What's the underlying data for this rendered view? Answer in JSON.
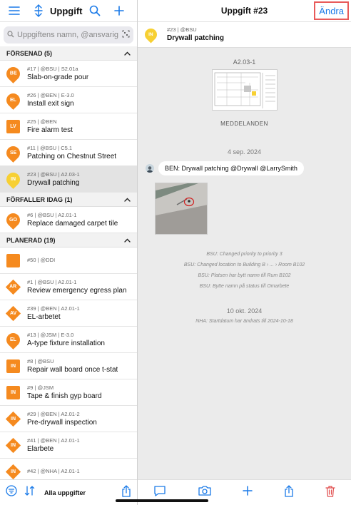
{
  "colors": {
    "accent": "#1a7ae8",
    "orange": "#f58a1f",
    "yellow": "#f7d033",
    "delete": "#e04a4a"
  },
  "left": {
    "title": "Uppgift",
    "search_placeholder": "Uppgiftens namn, @ansvarig, #t...",
    "sections": [
      {
        "label": "FÖRSENAD (5)",
        "items": [
          {
            "badge": "BE",
            "shape": "pin",
            "color": "orange",
            "meta": "#17 | @BSU | S2.01a",
            "name": "Slab-on-grade pour"
          },
          {
            "badge": "EL",
            "shape": "pin",
            "color": "orange",
            "meta": "#26 | @BEN | E-3.0",
            "name": "Install exit sign"
          },
          {
            "badge": "LV",
            "shape": "square",
            "color": "orange",
            "meta": "#25 | @BEN",
            "name": "Fire alarm test"
          },
          {
            "badge": "SE",
            "shape": "pin",
            "color": "orange",
            "meta": "#11 | @BSU | C5.1",
            "name": "Patching on Chestnut Street"
          },
          {
            "badge": "IN",
            "shape": "pin",
            "color": "yellow",
            "meta": "#23 | @BSU | A2.03-1",
            "name": "Drywall patching",
            "selected": true
          }
        ]
      },
      {
        "label": "FÖRFALLER IDAG (1)",
        "items": [
          {
            "badge": "GO",
            "shape": "pin",
            "color": "orange",
            "meta": "#6 | @BSU | A2.01-1",
            "name": "Replace damaged carpet tile"
          }
        ]
      },
      {
        "label": "PLANERAD (19)",
        "items": [
          {
            "badge": "",
            "shape": "square",
            "color": "orange",
            "meta": "#50 | @DDI",
            "name": ""
          },
          {
            "badge": "AR",
            "shape": "diamond",
            "color": "orange",
            "meta": "#1 | @BSU | A2.01-1",
            "name": "Review emergency egress plan"
          },
          {
            "badge": "AV",
            "shape": "diamond",
            "color": "orange",
            "meta": "#39 | @BEN | A2.01-1",
            "name": "EL-arbetet"
          },
          {
            "badge": "EL",
            "shape": "pin",
            "color": "orange",
            "meta": "#13 | @JSM | E-3.0",
            "name": "A-type fixture installation"
          },
          {
            "badge": "IN",
            "shape": "square",
            "color": "orange",
            "meta": "#8 | @BSU",
            "name": "Repair wall board once t-stat"
          },
          {
            "badge": "IN",
            "shape": "square",
            "color": "orange",
            "meta": "#9 | @JSM",
            "name": "Tape & finish gyp board"
          },
          {
            "badge": "IN",
            "shape": "diamond",
            "color": "orange",
            "meta": "#29 | @BEN | A2.01-2",
            "name": "Pre-drywall inspection"
          },
          {
            "badge": "IN",
            "shape": "diamond",
            "color": "orange",
            "meta": "#41 | @BEN | A2.01-1",
            "name": "Elarbete"
          },
          {
            "badge": "IN",
            "shape": "diamond",
            "color": "orange",
            "meta": "#42 | @NHA | A2.01-1",
            "name": ""
          }
        ]
      }
    ],
    "bottom_label": "Alla uppgifter"
  },
  "right": {
    "title": "Uppgift #23",
    "edit_label": "Ändra",
    "task": {
      "badge": "IN",
      "meta": "#23 | @BSU",
      "name": "Drywall patching"
    },
    "sheet_label": "A2.03-1",
    "messages_label": "MEDDELANDEN",
    "date1": "4 sep. 2024",
    "message": "BEN: Drywall patching @Drywall @LarrySmith",
    "log1": [
      "BSU: Changed priority to priority 3",
      "BSU: Changed location to Building B › ... › Room B102",
      "BSU: Platsen har bytt namn till Rum B102",
      "BSU: Bytte namn på status till Omarbete"
    ],
    "date2": "10 okt. 2024",
    "log2": "NHA: Startdatum har ändrats till 2024-10-18"
  }
}
